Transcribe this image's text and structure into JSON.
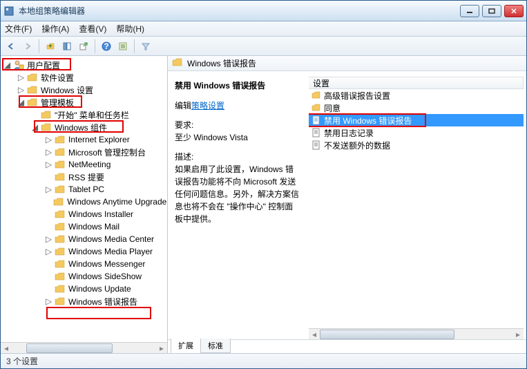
{
  "window": {
    "title": "本地组策略编辑器"
  },
  "menu": {
    "file": "文件(F)",
    "action": "操作(A)",
    "view": "查看(V)",
    "help": "帮助(H)"
  },
  "tree": {
    "root": "用户配置",
    "software_settings": "软件设置",
    "windows_settings": "Windows 设置",
    "admin_templates": "管理模板",
    "start_taskbar": "\"开始\" 菜单和任务栏",
    "windows_components": "Windows 组件",
    "ie": "Internet Explorer",
    "mmc_console": "Microsoft 管理控制台",
    "netmeeting": "NetMeeting",
    "rss": "RSS 提要",
    "tabletpc": "Tablet PC",
    "anytime": "Windows Anytime Upgrade",
    "installer": "Windows Installer",
    "mail": "Windows Mail",
    "mediacenter": "Windows Media Center",
    "mediaplayer": "Windows Media Player",
    "messenger": "Windows Messenger",
    "sideshow": "Windows SideShow",
    "update": "Windows Update",
    "error_reporting": "Windows 错误报告"
  },
  "rightheader": {
    "title": "Windows 错误报告"
  },
  "details": {
    "title": "禁用 Windows 错误报告",
    "edit_prefix": "编辑",
    "edit_link": "策略设置",
    "req_label": "要求:",
    "req_value": "至少 Windows Vista",
    "desc_label": "描述:",
    "desc_text": "如果启用了此设置，Windows 错误报告功能将不向 Microsoft 发送任何问题信息。另外，解决方案信息也将不会在 \"操作中心\" 控制面板中提供。"
  },
  "settings": {
    "header": "设置",
    "adv": "高级错误报告设置",
    "consent": "同意",
    "disable_wer": "禁用 Windows 错误报告",
    "disable_log": "禁用日志记录",
    "no_extra": "不发送额外的数据"
  },
  "tabs": {
    "ext": "扩展",
    "std": "标准"
  },
  "status": {
    "text": "3 个设置"
  }
}
